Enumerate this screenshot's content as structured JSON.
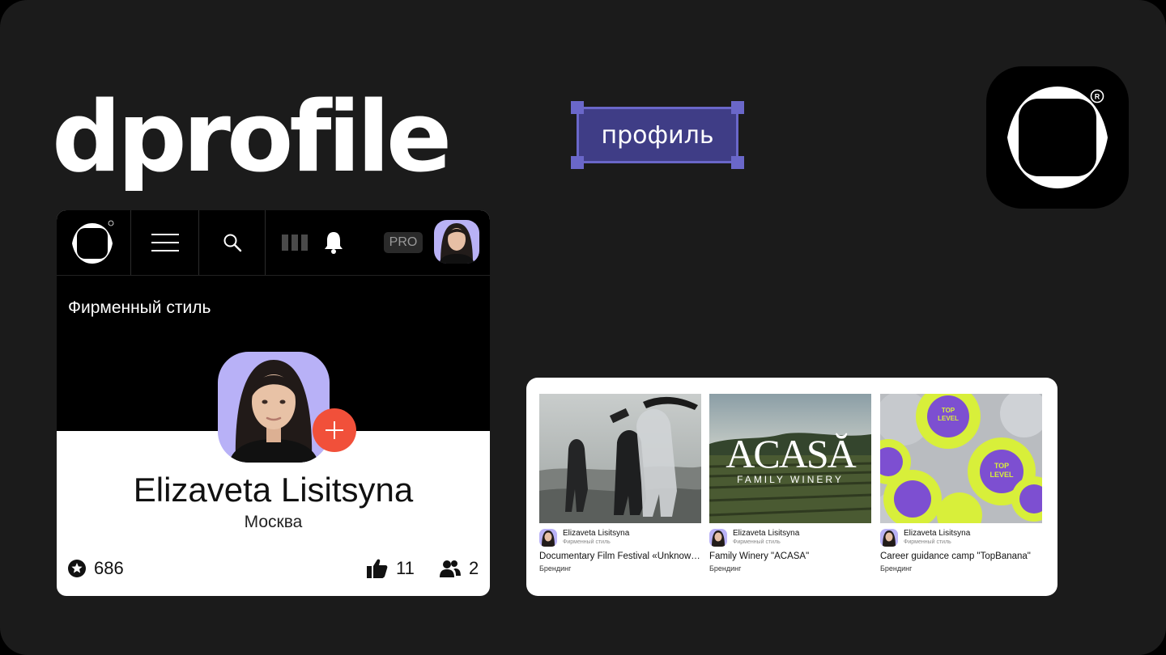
{
  "brand": {
    "wordmark": "dprofile",
    "tag": "профиль"
  },
  "profile_card": {
    "pro_badge": "PRO",
    "cover_title": "Фирменный стиль",
    "name": "Elizaveta Lisitsyna",
    "city": "Москва",
    "stats": {
      "stars": "686",
      "likes": "11",
      "followers": "2"
    },
    "icons": [
      "logo-icon",
      "menu-icon",
      "search-icon",
      "bars-icon",
      "bell-icon",
      "star-icon",
      "thumbs-up-icon",
      "users-icon",
      "plus-icon"
    ]
  },
  "portfolio": {
    "items": [
      {
        "author": "Elizaveta Lisitsyna",
        "author_category": "Фирменный стиль",
        "title": "Documentary Film Festival «Unknown»",
        "category": "Брендинг"
      },
      {
        "author": "Elizaveta Lisitsyna",
        "author_category": "Фирменный стиль",
        "title": "Family Winery \"ACASĂ\"",
        "category": "Брендинг",
        "image_text": "ACASĂ",
        "image_subtext": "FAMILY WINERY"
      },
      {
        "author": "Elizaveta Lisitsyna",
        "author_category": "Фирменный стиль",
        "title": "Career guidance camp \"TopBanana\"",
        "category": "Брендинг",
        "image_text": "TOP LEVEL"
      }
    ]
  },
  "colors": {
    "background": "#1b1b1b",
    "accent_purple": "#3f3d86",
    "handle_purple": "#6a67c9",
    "avatar_lilac": "#b8b1f7",
    "plus_red": "#f1503a",
    "badge_yellow": "#d8ef3a",
    "badge_violet": "#7d4fd1"
  }
}
